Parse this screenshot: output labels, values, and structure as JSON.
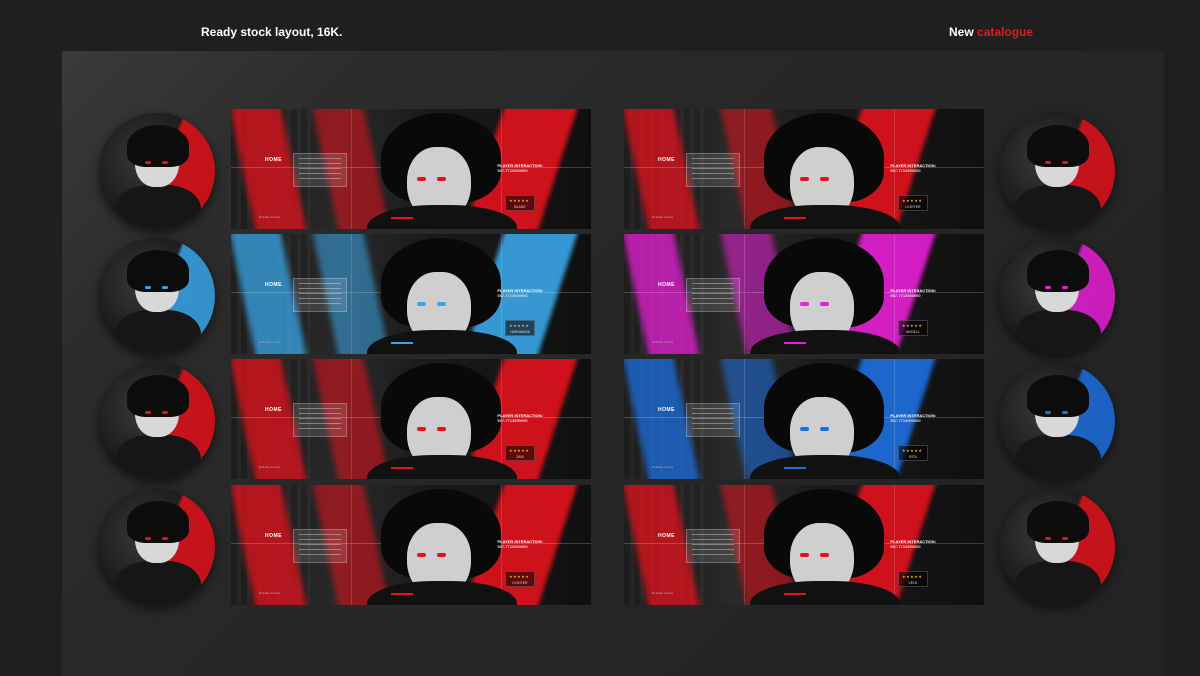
{
  "header": {
    "left_text": "Ready stock layout, 16K.",
    "right_prefix": "New",
    "right_accent": "catalogue"
  },
  "colors": {
    "accent_red": "#d81f26",
    "red": "#e3121c",
    "blue": "#3aa6e8",
    "magenta": "#e81fd6",
    "cobalt": "#1d6fe0",
    "star": "#f2b120"
  },
  "banner_common": {
    "home": "HOME",
    "player_label": "PLAYER INTERACTION:",
    "player_id": "567-7713950000",
    "stars": "★★★★★",
    "footer": "Reliable Access"
  },
  "banners": [
    {
      "name": "BLADE",
      "accent": "red"
    },
    {
      "name": "LIGHTER",
      "accent": "red"
    },
    {
      "name": "HARUMASA",
      "accent": "blue"
    },
    {
      "name": "ANGELL",
      "accent": "magenta"
    },
    {
      "name": "ZAKI",
      "accent": "red"
    },
    {
      "name": "RITA",
      "accent": "cobalt"
    },
    {
      "name": "LIGHTER",
      "accent": "red"
    },
    {
      "name": "VEHL",
      "accent": "red"
    }
  ]
}
